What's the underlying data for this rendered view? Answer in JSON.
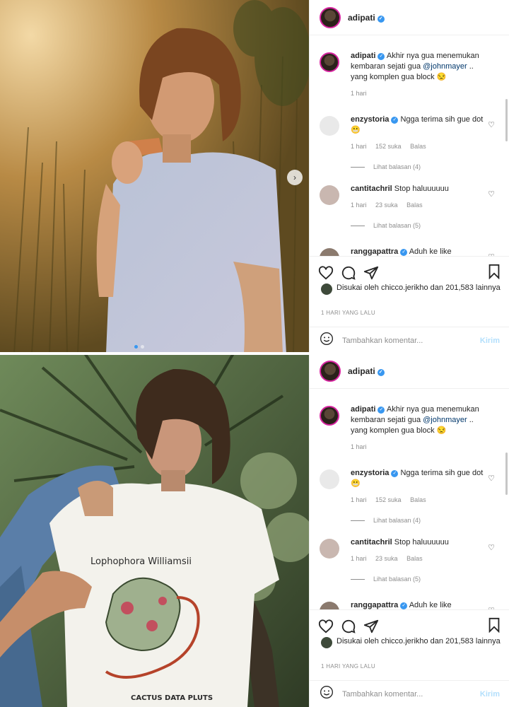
{
  "post": {
    "username": "adipati",
    "caption_user": "adipati",
    "caption_text_1": "Akhir nya gua menemukan kembaran sejati gua ",
    "caption_mention": "@johnmayer",
    "caption_text_2": " .. yang komplen gua block ",
    "caption_emoji": "😒",
    "caption_time": "1 hari",
    "comments": [
      {
        "user": "enzystoria",
        "text": "Ngga terima sih gue dot",
        "emoji": "😬",
        "time": "1 hari",
        "likes": "152 suka",
        "reply": "Balas",
        "view_replies": "Lihat balasan (4)"
      },
      {
        "user": "cantitachril",
        "text": "Stop haluuuuuu",
        "time": "1 hari",
        "likes": "23 suka",
        "reply": "Balas",
        "view_replies": "Lihat balasan (5)"
      },
      {
        "user": "ranggapattra",
        "text": "Aduh ke like"
      }
    ],
    "liked_by_prefix": "Disukai oleh ",
    "liked_by_user": "chicco.jerikho",
    "liked_by_suffix": " dan 201,583 lainnya",
    "timestamp": "1 HARI YANG LALU",
    "add_comment_placeholder": "Tambahkan komentar...",
    "post_button": "Kirim"
  },
  "photo2": {
    "shirt_line1": "Lophophora Williamsii",
    "shirt_line2": "CACTUS DATA PLUTS"
  },
  "colors": {
    "accent": "#3897f0",
    "muted": "#8e8e8e",
    "post_disabled": "#b2dffc"
  },
  "icons": [
    "heart-icon",
    "comment-icon",
    "share-icon",
    "bookmark-icon",
    "emoji-icon",
    "verified-icon",
    "chevron-right-icon"
  ]
}
